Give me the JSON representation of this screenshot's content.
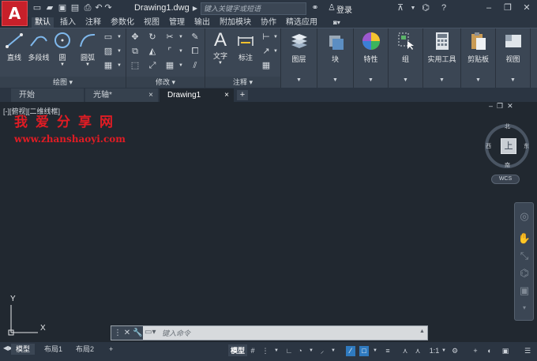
{
  "app": {
    "logo_letter": "A",
    "doc_title": "Drawing1.dwg",
    "search_placeholder": "键入关键字或短语",
    "login": "登录",
    "help": "?"
  },
  "ribbon_tabs": [
    "默认",
    "插入",
    "注释",
    "参数化",
    "视图",
    "管理",
    "输出",
    "附加模块",
    "协作",
    "精选应用"
  ],
  "ribbon_tabs_active": 0,
  "panels": {
    "draw": {
      "title": "绘图",
      "tools": [
        "直线",
        "多段线",
        "圆",
        "圆弧"
      ]
    },
    "modify": {
      "title": "修改"
    },
    "annotation": {
      "title": "注释",
      "tools": [
        "文字",
        "标注"
      ]
    },
    "big": [
      "图层",
      "块",
      "特性",
      "组",
      "实用工具",
      "剪贴板",
      "视图"
    ]
  },
  "file_tabs": [
    {
      "label": "开始"
    },
    {
      "label": "光轴*",
      "close": "×"
    },
    {
      "label": "Drawing1",
      "close": "×"
    }
  ],
  "file_tab_plus": "+",
  "drawing": {
    "view_label": "[-][俯视][二维线框]",
    "watermark_cn": "我爱分享网",
    "watermark_url": "www.zhanshaoyi.com",
    "viewcube": {
      "face": "上",
      "north": "北",
      "south": "南",
      "east": "东",
      "west": "西",
      "wcs": "WCS"
    },
    "ucs_y": "Y",
    "ucs_x": "X"
  },
  "command": {
    "placeholder": "键入命令"
  },
  "layout_tabs": [
    "模型",
    "布局1",
    "布局2"
  ],
  "layout_plus": "+",
  "status": {
    "model": "模型",
    "scale": "1:1"
  },
  "colors": {
    "accent": "#c8202a",
    "watermark": "#e01c24",
    "toggle_on": "#2f7abf"
  }
}
